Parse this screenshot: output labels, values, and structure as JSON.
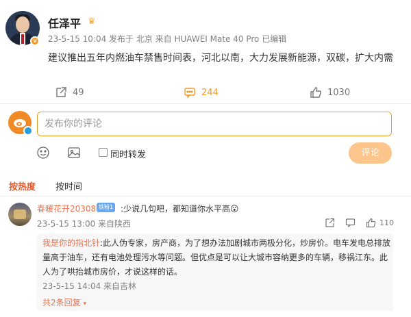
{
  "post": {
    "author": "任泽平",
    "meta": "23-5-15 10:04  发布于 北京  来自 HUAWEI Mate 40 Pro 已编辑",
    "text": "建议推出五年内燃油车禁售时间表，河北以南，大力发展新能源，双碳，扩大内需",
    "reposts": "49",
    "comments": "244",
    "likes": "1030"
  },
  "composer": {
    "placeholder": "发布你的评论",
    "repost_label": "同时转发",
    "submit_label": "评论"
  },
  "sort": {
    "hot": "按热度",
    "time": "按时间"
  },
  "comment": {
    "user": "春暖花开20308",
    "badge": "铁粉1",
    "text": ":少说几句吧，都知道你水平高😮",
    "meta": "23-5-15 13:00  来自陕西",
    "likes": "110",
    "reply": {
      "user": "我是你的指北针",
      "text": ":此人伪专家，房产商，为了想办法加剧城市两极分化，炒房价。电车发电总排放量高于油车，还有电池处理污水等问题。但优点是可以让大城市容纳更多的车辆，移祸江东。此人为了哄抬城市房价，才说这样的话。",
      "meta": "23-5-15 14:04  来自吉林",
      "more": "共2条回复"
    }
  },
  "colors": {
    "accent": "#f59a23",
    "link": "#eb7350",
    "hot_tab": "#e9582a",
    "submit_bg": "#fbc58b"
  },
  "icons": [
    "crown-icon",
    "repost-icon",
    "comment-icon",
    "like-icon",
    "emoji-icon",
    "image-icon",
    "share-icon",
    "reply-icon"
  ]
}
